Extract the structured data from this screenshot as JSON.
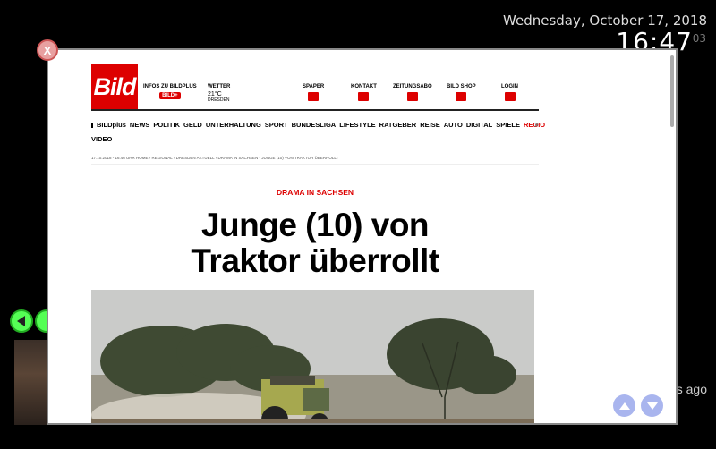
{
  "clock": {
    "date": "Wednesday, October 17, 2018",
    "time": "16:47",
    "seconds": "03"
  },
  "background": {
    "side_text": "es ago"
  },
  "popup": {
    "header": {
      "logo": "Bild",
      "items": [
        {
          "label": "INFOS ZU BILDPLUS",
          "badge": "BILD+"
        },
        {
          "label": "WETTER",
          "temp": "21°C",
          "city": "DRESDEN"
        },
        {
          "label": "SPAPER"
        },
        {
          "label": "KONTAKT"
        },
        {
          "label": "ZEITUNGSABO"
        },
        {
          "label": "BILD SHOP"
        },
        {
          "label": "LOGIN"
        }
      ]
    },
    "nav": {
      "items": [
        "BILDplus",
        "NEWS",
        "POLITIK",
        "GELD",
        "UNTERHALTUNG",
        "SPORT",
        "BUNDESLIGA",
        "LIFESTYLE",
        "RATGEBER",
        "REISE",
        "AUTO",
        "DIGITAL",
        "SPIELE",
        "REGIO"
      ],
      "second_row": "VIDEO"
    },
    "breadcrumb": "17.10.2018 - 16:46 UHR   HOME › REGIONAL › DRESDEN AKTUELL › DRAMA IN SACHSEN - JUNGE (10) VON TRAKTOR ÜBERROLLT",
    "kicker": "DRAMA IN SACHSEN",
    "headline_line1": "Junge (10) von",
    "headline_line2": "Traktor überrollt"
  },
  "colors": {
    "bild_red": "#dd0000",
    "nav_green": "#55ff55",
    "scroll_blue": "#a9b5ee"
  },
  "icons": [
    "close-icon",
    "arrow-left-icon",
    "arrow-up-icon",
    "arrow-down-icon",
    "search-icon"
  ]
}
